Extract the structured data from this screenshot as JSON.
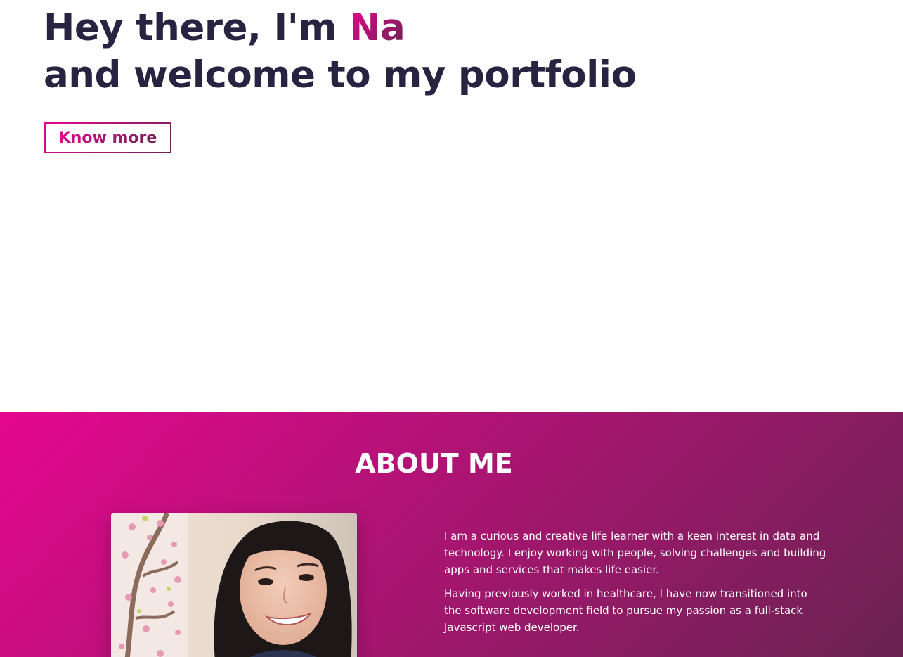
{
  "hero": {
    "title_prefix": "Hey there, I'm ",
    "name": "Na",
    "title_line2": "and welcome to my portfolio",
    "cta_label": "Know more"
  },
  "about": {
    "heading": "ABOUT ME",
    "paragraph_1": "I am a curious and creative life learner with a keen interest in data and technology. I enjoy working with people, solving challenges and building apps and services that makes life easier.",
    "paragraph_2": "Having previously worked in healthcare, I have now transitioned into the software development field to pursue my passion as a full-stack Javascript web developer."
  },
  "colors": {
    "heading_dark": "#272341",
    "gradient_start": "#e5078f",
    "gradient_end": "#6a2352",
    "white": "#ffffff"
  }
}
